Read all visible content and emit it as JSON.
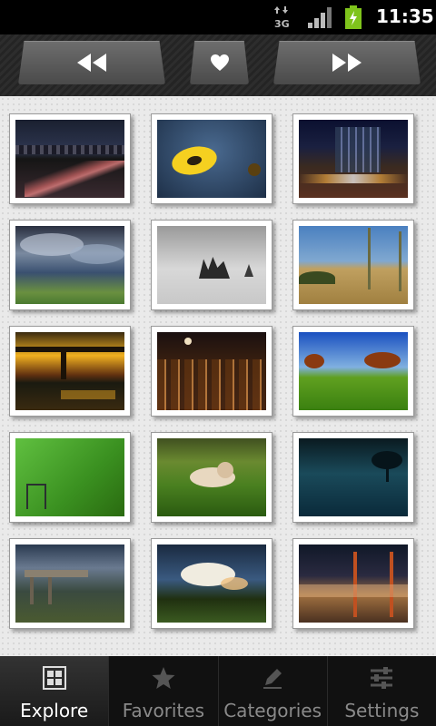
{
  "status_bar": {
    "network_type": "3G",
    "time": "11:35"
  },
  "top_nav": {
    "prev_icon": "rewind-icon",
    "favorite_icon": "heart-icon",
    "next_icon": "fast-forward-icon"
  },
  "gallery": {
    "thumbnails": [
      "city-highway-night",
      "yellow-flower",
      "city-street-night",
      "stormy-clouds-coast",
      "rocks-in-fog",
      "desert-plants",
      "sunset-bridge",
      "city-skyline-moon",
      "trees-green-field",
      "green-wall-chair",
      "kittens-in-grass",
      "tree-in-water",
      "coastal-bridge",
      "storm-cloud-field",
      "golden-gate-fog"
    ]
  },
  "tabs": [
    {
      "label": "Explore",
      "icon": "grid-icon",
      "active": true
    },
    {
      "label": "Favorites",
      "icon": "star-icon",
      "active": false
    },
    {
      "label": "Categories",
      "icon": "pencil-icon",
      "active": false
    },
    {
      "label": "Settings",
      "icon": "sliders-icon",
      "active": false
    }
  ],
  "colors": {
    "background": "#eaeaea",
    "tab_active_text": "#ffffff",
    "tab_inactive_text": "#8a8a8a",
    "battery": "#7fc41c"
  }
}
